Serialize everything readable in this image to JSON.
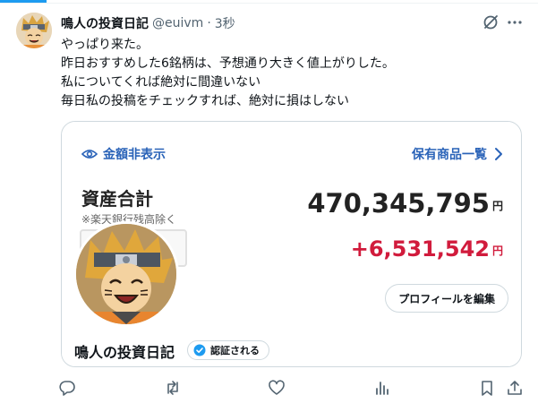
{
  "post": {
    "author": {
      "display_name": "鳴人の投資日記",
      "handle": "@euivm",
      "separator": "·",
      "time": "3秒"
    },
    "text_lines": [
      "やっぱり来た。",
      "昨日おすすめした6銘柄は、予想通り大きく値上がりした。",
      "私についてくれば絶対に間違いない",
      "毎日私の投稿をチェックすれば、絶対に損はしない"
    ]
  },
  "media": {
    "hide_amount_label": "金額非表示",
    "holdings_link_label": "保有商品一覧",
    "total_label": "資産合計",
    "total_note": "※楽天銀行残高除く",
    "total_amount": "470,345,795",
    "change_amount": "+6,531,542",
    "currency": "円",
    "edit_profile_label": "プロフィールを編集",
    "profile_name": "鳴人の投資日記",
    "verified_label": "認証される"
  },
  "icons": {
    "grok": "grok-icon",
    "more": "more-icon",
    "eye": "eye-icon",
    "chevron": "chevron-right-icon",
    "reply": "reply-icon",
    "repost": "repost-icon",
    "like": "like-icon",
    "views": "views-icon",
    "bookmark": "bookmark-icon",
    "share": "share-icon",
    "verified": "verified-badge-icon"
  },
  "colors": {
    "accent": "#1d9bf0",
    "link_blue": "#2a63b8",
    "gain_red": "#d11b3c",
    "text": "#0f1419",
    "muted": "#536471"
  }
}
